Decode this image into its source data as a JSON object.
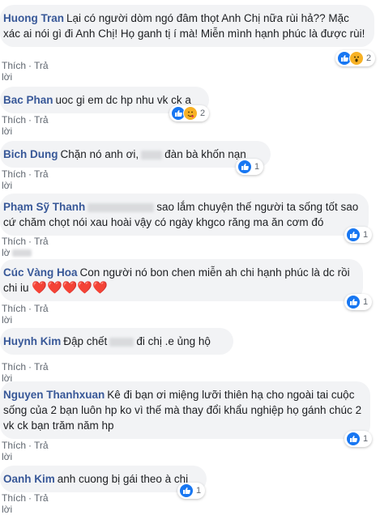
{
  "comments": [
    {
      "author": "Huong Tran",
      "text": "Lại có người dòm ngó đâm thọt Anh Chị nữa rùi hả?? Mặc xác ai nói gì đi Anh Chị! Họ ganh tị í mà! Miễn mình hạnh phúc là được rùi!",
      "like": "Thích",
      "reply": "Trả lời",
      "reaction_count": "2",
      "reactions": [
        "like-icon",
        "wow-icon"
      ]
    },
    {
      "author": "Bac Phan",
      "text": "uoc gi em dc hp nhu vk ck a",
      "like": "Thích",
      "reply": "Trả lời",
      "reaction_count": "2",
      "reactions": [
        "like-icon",
        "care-icon"
      ]
    },
    {
      "author": "Bich Dung",
      "text_before": "Chặn nó anh ơi,",
      "text_after": "đàn bà khốn nạn",
      "like": "Thích",
      "reply": "Trả lời",
      "reaction_count": "1",
      "reactions": [
        "like-icon"
      ]
    },
    {
      "author": "Phạm Sỹ Thanh",
      "text": "sao lắm chuyện thế người ta sống tốt sao cứ chăm chọt nói xau hoài vậy có ngày khgco răng ma ăn cơm đó",
      "like": "Thích",
      "reply": "Trả lờ",
      "reaction_count": "1",
      "reactions": [
        "like-icon"
      ]
    },
    {
      "author": "Cúc Vàng Hoa",
      "text": "Con người nó bon chen miễn ah chi hạnh phúc là dc rồi chi iu",
      "hearts": "❤️❤️❤️❤️❤️",
      "like": "Thích",
      "reply": "Trả lời",
      "reaction_count": "1",
      "reactions": [
        "like-icon"
      ]
    },
    {
      "author": "Huynh Kim",
      "text_before": "Đập chết",
      "text_after": "đi chị .e ủng hộ",
      "like": "Thích",
      "reply": "Trả lời"
    },
    {
      "author": "Nguyen Thanhxuan",
      "text": "Kê đi bạn ơi miệng lưỡi thiên hạ cho ngoài tai cuộc sống của 2 bạn luôn hp ko vì thế mà thay đổi khẩu nghiệp họ gánh chúc 2 vk ck bạn trăm năm hp",
      "like": "Thích",
      "reply": "Trả lời",
      "reaction_count": "1",
      "reactions": [
        "like-icon"
      ]
    },
    {
      "author": "Oanh Kim",
      "text": "anh cuong bị gái theo à chị",
      "like": "Thích",
      "reply": "Trả lời",
      "reaction_count": "1",
      "reactions": [
        "like-icon"
      ]
    }
  ],
  "colors": {
    "author": "#385898",
    "bubble": "#f2f3f5",
    "like_reaction": "#1877f2",
    "meta": "#606770"
  }
}
